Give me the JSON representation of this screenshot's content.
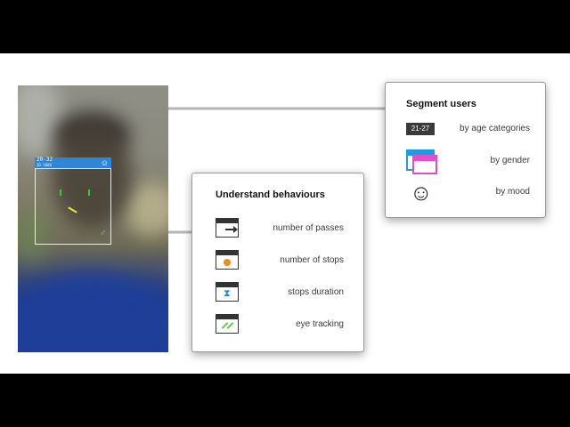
{
  "camera": {
    "face_age": "20-32",
    "face_sub": "ID 5080",
    "gender_symbol": "♂",
    "smile_symbol": "☺"
  },
  "segment_panel": {
    "title": "Segment users",
    "age_badge": "21-27",
    "rows": [
      {
        "label": "by age categories"
      },
      {
        "label": "by gender"
      },
      {
        "label": "by mood"
      }
    ],
    "mood_symbol": "☺"
  },
  "behaviours_panel": {
    "title": "Understand behaviours",
    "rows": [
      {
        "label": "number of passes"
      },
      {
        "label": "number of stops"
      },
      {
        "label": "stops duration"
      },
      {
        "label": "eye tracking"
      }
    ],
    "hourglass_symbol": "⧗"
  },
  "colors": {
    "face_header": "#2f86d6",
    "eye_marker": "#2fd23a",
    "gaze_marker": "#f2e626",
    "gender_blue": "#1e9be0",
    "gender_pink": "#e04fcb",
    "stop_dot": "#ef8c16",
    "eye_tracking": "#5fcf3a"
  }
}
